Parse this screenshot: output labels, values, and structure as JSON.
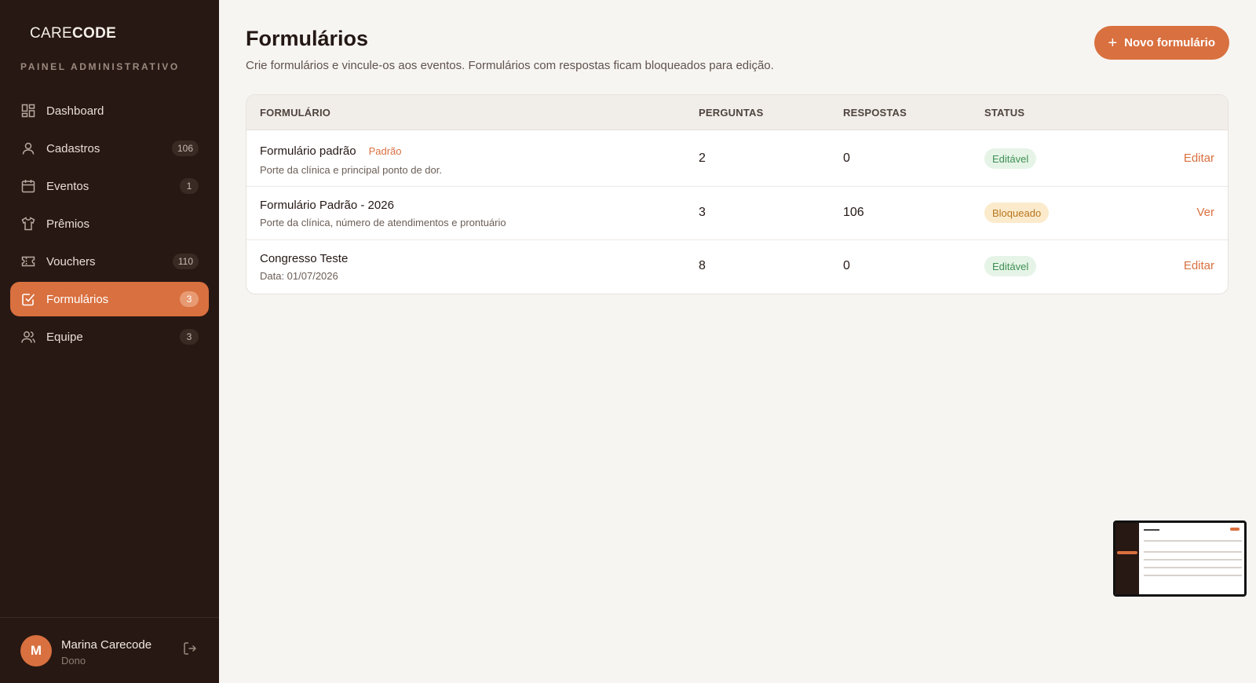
{
  "sidebar": {
    "logo_prefix": "CARE",
    "logo_suffix": "CODE",
    "panel_label": "PAINEL ADMINISTRATIVO",
    "items": [
      {
        "label": "Dashboard",
        "icon": "dashboard-icon",
        "badge": ""
      },
      {
        "label": "Cadastros",
        "icon": "user-icon",
        "badge": "106"
      },
      {
        "label": "Eventos",
        "icon": "calendar-icon",
        "badge": "1"
      },
      {
        "label": "Prêmios",
        "icon": "shirt-icon",
        "badge": ""
      },
      {
        "label": "Vouchers",
        "icon": "ticket-icon",
        "badge": "110"
      },
      {
        "label": "Formulários",
        "icon": "checkbox-icon",
        "badge": "3",
        "active": true
      },
      {
        "label": "Equipe",
        "icon": "users-icon",
        "badge": "3"
      }
    ],
    "user": {
      "initial": "M",
      "name": "Marina Carecode",
      "role": "Dono"
    }
  },
  "header": {
    "title": "Formulários",
    "subtitle": "Crie formulários e vincule-os aos eventos. Formulários com respostas ficam bloqueados para edição.",
    "new_button": "Novo formulário"
  },
  "table": {
    "columns": [
      "FORMULÁRIO",
      "PERGUNTAS",
      "RESPOSTAS",
      "STATUS"
    ],
    "rows": [
      {
        "name": "Formulário padrão",
        "tag": "Padrão",
        "desc": "Porte da clínica e principal ponto de dor.",
        "perguntas": "2",
        "respostas": "0",
        "status": "Editável",
        "status_type": "editavel",
        "action": "Editar"
      },
      {
        "name": "Formulário Padrão - 2026",
        "tag": "",
        "desc": "Porte da clínica, número de atendimentos e prontuário",
        "perguntas": "3",
        "respostas": "106",
        "status": "Bloqueado",
        "status_type": "bloqueado",
        "action": "Ver"
      },
      {
        "name": "Congresso Teste",
        "tag": "",
        "desc": "Data: 01/07/2026",
        "perguntas": "8",
        "respostas": "0",
        "status": "Editável",
        "status_type": "editavel",
        "action": "Editar"
      }
    ]
  },
  "colors": {
    "accent": "#d9703f",
    "sidebar_bg": "#271813",
    "page_bg": "#f7f5f2"
  }
}
